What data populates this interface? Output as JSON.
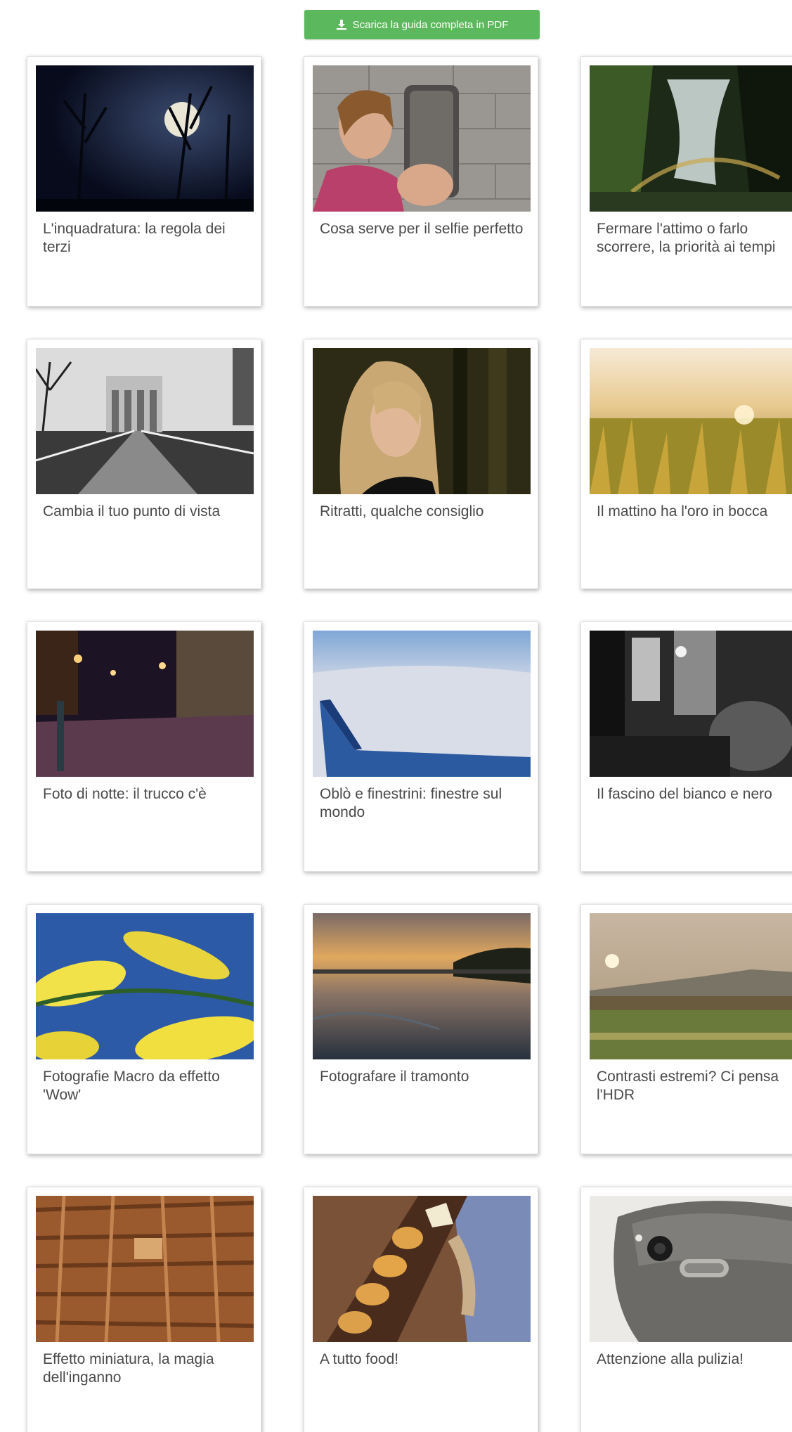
{
  "download_button": {
    "label": "Scarica la guida completa in PDF",
    "icon": "download-icon",
    "color": "#5cb85c"
  },
  "cards": [
    {
      "title": "L'inquadratura: la regola dei terzi"
    },
    {
      "title": "Cosa serve per il selfie perfetto"
    },
    {
      "title": "Fermare l'attimo o farlo scorrere, la priorità ai tempi"
    },
    {
      "title": "Cambia il tuo punto di vista"
    },
    {
      "title": "Ritratti, qualche consiglio"
    },
    {
      "title": "Il mattino ha l'oro in bocca"
    },
    {
      "title": "Foto di notte: il trucco c'è"
    },
    {
      "title": "Oblò e finestrini: finestre sul mondo"
    },
    {
      "title": "Il fascino del bianco e nero"
    },
    {
      "title": "Fotografie Macro da effetto 'Wow'"
    },
    {
      "title": "Fotografare il tramonto"
    },
    {
      "title": "Contrasti estremi? Ci pensa l'HDR"
    },
    {
      "title": "Effetto miniatura, la magia dell'inganno"
    },
    {
      "title": "A tutto food!"
    },
    {
      "title": "Attenzione alla pulizia!"
    }
  ]
}
